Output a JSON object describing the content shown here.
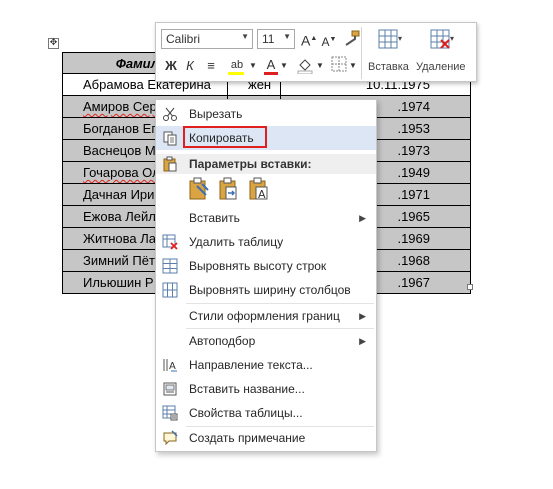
{
  "table": {
    "header": [
      "Фамилия",
      "",
      ""
    ],
    "rows": [
      {
        "name": "Абрамова Екатерина",
        "gender": "жен",
        "date": "10.11.1975"
      },
      {
        "name": "Амиров Сер",
        "gender": "",
        "date": ".1974"
      },
      {
        "name": "Богданов Ег",
        "gender": "",
        "date": ".1953"
      },
      {
        "name": "Васнецов М",
        "gender": "",
        "date": ".1973"
      },
      {
        "name": "Гочарова Ол",
        "gender": "",
        "date": ".1949"
      },
      {
        "name": "Дачная Ири",
        "gender": "",
        "date": ".1971"
      },
      {
        "name": "Ежова Лейл",
        "gender": "",
        "date": ".1965"
      },
      {
        "name": "Житнова Ла",
        "gender": "",
        "date": ".1969"
      },
      {
        "name": "Зимний Пёт",
        "gender": "",
        "date": ".1968"
      },
      {
        "name": "Ильюшин Р",
        "gender": "",
        "date": ".1967"
      }
    ]
  },
  "toolbar": {
    "font_name": "Calibri",
    "font_size": "11",
    "grow_font": "A",
    "shrink_font": "A",
    "bold": "Ж",
    "italic": "К",
    "align": "≡",
    "highlight": "ab",
    "font_color": "A",
    "insert_label": "Вставка",
    "delete_label": "Удаление"
  },
  "menu": {
    "cut": "Вырезать",
    "copy": "Копировать",
    "paste_options": "Параметры вставки:",
    "insert": "Вставить",
    "delete_table": "Удалить таблицу",
    "distribute_rows": "Выровнять высоту строк",
    "distribute_cols": "Выровнять ширину столбцов",
    "border_styles": "Стили оформления границ",
    "autofit": "Автоподбор",
    "text_direction": "Направление текста...",
    "insert_caption": "Вставить название...",
    "table_properties": "Свойства таблицы...",
    "new_comment": "Создать примечание"
  },
  "colors": {
    "accent": "#e01f1f",
    "highlight_row": "#dce6f4",
    "selection": "#c6c6c6"
  }
}
